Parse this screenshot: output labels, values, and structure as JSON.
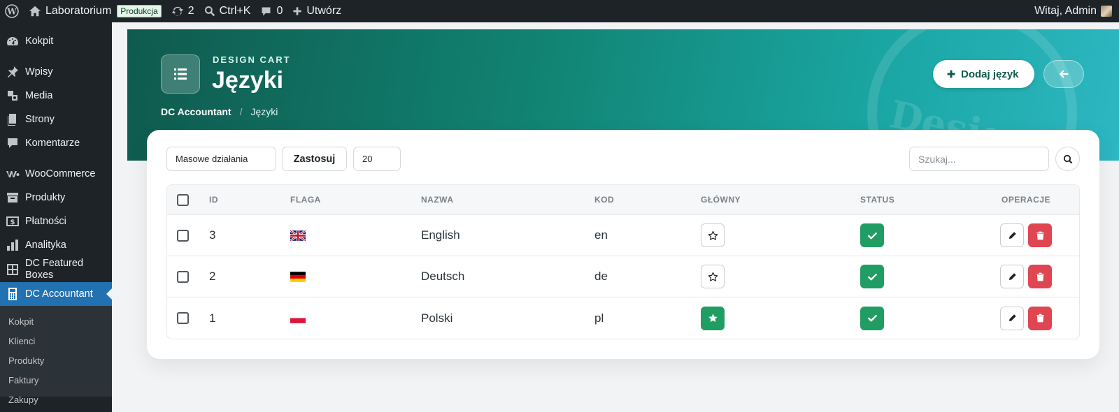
{
  "adminbar": {
    "site_name": "Laboratorium",
    "env_badge": "Produkcja",
    "updates_count": "2",
    "search_shortcut": "Ctrl+K",
    "comments_count": "0",
    "new_label": "Utwórz",
    "greeting": "Witaj, Admin"
  },
  "sidebar": {
    "items": [
      {
        "label": "Kokpit",
        "icon": "dashboard-icon"
      },
      {
        "label": "Wpisy",
        "icon": "pin-icon"
      },
      {
        "label": "Media",
        "icon": "media-icon"
      },
      {
        "label": "Strony",
        "icon": "pages-icon"
      },
      {
        "label": "Komentarze",
        "icon": "comment-icon"
      },
      {
        "label": "WooCommerce",
        "icon": "woocommerce-icon"
      },
      {
        "label": "Produkty",
        "icon": "archive-icon"
      },
      {
        "label": "Płatności",
        "icon": "money-icon"
      },
      {
        "label": "Analityka",
        "icon": "chart-icon"
      },
      {
        "label": "DC Featured Boxes",
        "icon": "grid-icon"
      },
      {
        "label": "DC Accountant",
        "icon": "calculator-icon"
      }
    ],
    "submenu": [
      "Kokpit",
      "Klienci",
      "Produkty",
      "Faktury",
      "Zakupy"
    ]
  },
  "hero": {
    "eyebrow": "DESIGN CART",
    "title": "Języki",
    "watermark": "Design",
    "breadcrumb_root": "DC Accountant",
    "breadcrumb_sep": "/",
    "breadcrumb_current": "Języki",
    "add_button": "Dodaj język"
  },
  "toolbar": {
    "bulk_actions": "Masowe działania",
    "apply": "Zastosuj",
    "per_page": "20",
    "search_placeholder": "Szukaj..."
  },
  "table": {
    "headers": {
      "id": "ID",
      "flag": "FLAGA",
      "name": "NAZWA",
      "code": "KOD",
      "main": "GŁÓWNY",
      "status": "STATUS",
      "ops": "OPERACJE"
    },
    "rows": [
      {
        "id": "3",
        "flag": "gb",
        "name": "English",
        "code": "en",
        "is_main": false,
        "active": true
      },
      {
        "id": "2",
        "flag": "de",
        "name": "Deutsch",
        "code": "de",
        "is_main": false,
        "active": true
      },
      {
        "id": "1",
        "flag": "pl",
        "name": "Polski",
        "code": "pl",
        "is_main": true,
        "active": true
      }
    ]
  },
  "colors": {
    "accent": "#1f9d63",
    "danger": "#e04552",
    "wp_blue": "#2271b1",
    "hero_dark": "#0f5a4e",
    "hero_light": "#2db7c2"
  }
}
